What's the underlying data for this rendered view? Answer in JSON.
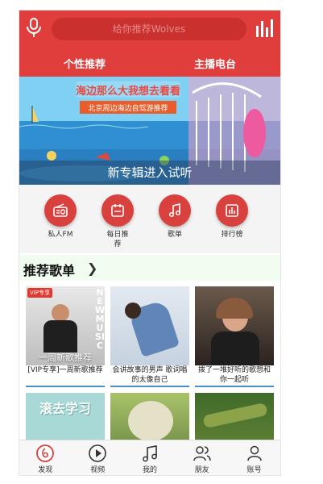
{
  "header": {
    "search_placeholder": "给你推荐Wolves",
    "tabs": [
      "个性推荐",
      "主播电台"
    ]
  },
  "banner": {
    "headline": "海边那么大我想去看看",
    "ribbon": "北京周边海边自驾游推荐",
    "caption": "新专辑进入试听"
  },
  "quick_links": [
    {
      "label": "私人FM",
      "icon": "radio-icon"
    },
    {
      "label": "每日推荐",
      "icon": "calendar-icon"
    },
    {
      "label": "歌单",
      "icon": "music-note-icon"
    },
    {
      "label": "排行榜",
      "icon": "chart-bars-icon"
    }
  ],
  "section": {
    "title": "推荐歌单"
  },
  "playlists": [
    {
      "title": "[VIP专享]一周新歌推荐",
      "badge": "VIP专享",
      "cover_text": "一周新歌推荐",
      "side_text": "NEW MUSIC"
    },
    {
      "title": "会讲故事的男声 歌词唱的太像自己",
      "badge": "",
      "cover_text": ""
    },
    {
      "title": "拨了一堆好听的歌想和你一起听",
      "badge": "",
      "cover_text": ""
    },
    {
      "title": "",
      "badge": "",
      "cover_text": "滚去学习"
    },
    {
      "title": "",
      "badge": "",
      "cover_text": ""
    },
    {
      "title": "",
      "badge": "",
      "cover_text": ""
    }
  ],
  "tabbar": [
    {
      "label": "发现",
      "icon": "discover-icon",
      "active": true
    },
    {
      "label": "视频",
      "icon": "video-play-icon",
      "active": false
    },
    {
      "label": "我的",
      "icon": "music-note-icon",
      "active": false
    },
    {
      "label": "朋友",
      "icon": "friends-icon",
      "active": false
    },
    {
      "label": "账号",
      "icon": "account-icon",
      "active": false
    }
  ],
  "colors": {
    "brand_red": "#df3e3c",
    "search_bg": "#c9302e",
    "section_bg": "#f0fdf0",
    "underline_blue": "#4b8ec8"
  }
}
